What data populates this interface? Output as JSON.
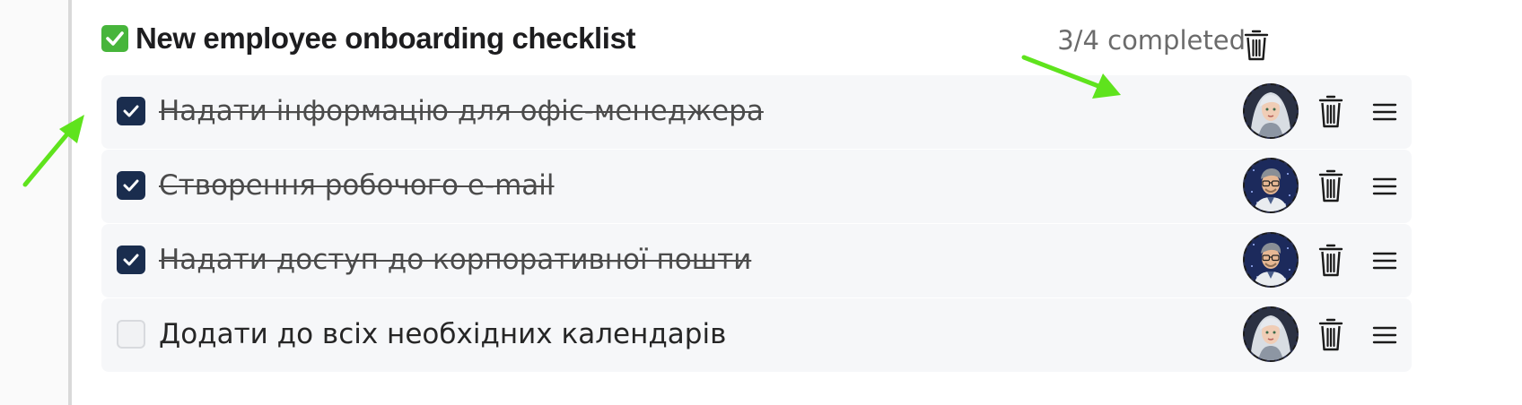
{
  "checklist": {
    "title": "New employee onboarding checklist",
    "title_icon": "check-mark-emoji-icon",
    "status": "3/4 completed",
    "items": [
      {
        "label": "Надати інформацію для офіс-менеджера",
        "checked": true,
        "assignee": "avatar-woman-silver-hair"
      },
      {
        "label": "Створення робочого e-mail",
        "checked": true,
        "assignee": "avatar-man-glasses"
      },
      {
        "label": "Надати доступ до корпоративної пошти",
        "checked": true,
        "assignee": "avatar-man-glasses"
      },
      {
        "label": "Додати до всіх необхідних календарів",
        "checked": false,
        "assignee": "avatar-woman-silver-hair"
      }
    ]
  },
  "colors": {
    "checkbox_checked": "#1a2d4e",
    "row_background": "#f6f7f9",
    "annotation_arrow": "#5fe31d",
    "emoji_green": "#47b53b"
  }
}
